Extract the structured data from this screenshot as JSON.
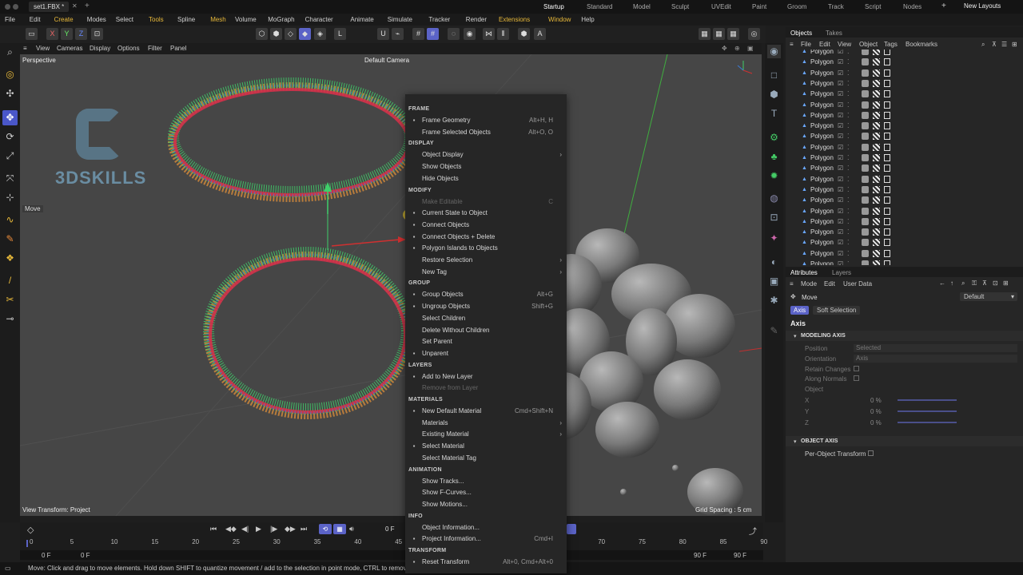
{
  "titlebar": {
    "doc_tab": "set1.FBX *",
    "layouts": [
      "Startup",
      "Standard",
      "Model",
      "Sculpt",
      "UVEdit",
      "Paint",
      "Groom",
      "Track",
      "Script",
      "Nodes"
    ],
    "active_layout": "Startup",
    "new_layouts": "New Layouts"
  },
  "menu": [
    "File",
    "Edit",
    "Create",
    "Modes",
    "Select",
    "Tools",
    "Spline",
    "Mesh",
    "Volume",
    "MoGraph",
    "Character",
    "Animate",
    "Simulate",
    "Tracker",
    "Render",
    "Extensions",
    "Window",
    "Help"
  ],
  "viewport": {
    "menu": [
      "View",
      "Cameras",
      "Display",
      "Options",
      "Filter",
      "Panel"
    ],
    "label": "Perspective",
    "camera": "Default Camera",
    "view_transform": "View Transform: Project",
    "grid_spacing": "Grid Spacing : 5 cm",
    "move_label": "Move",
    "logo_text": "3DSKILLS"
  },
  "context_menu": {
    "sections": [
      {
        "title": "FRAME",
        "items": [
          {
            "label": "Frame Geometry",
            "shortcut": "Alt+H, H",
            "icon": "frame-icon"
          },
          {
            "label": "Frame Selected Objects",
            "shortcut": "Alt+O, O",
            "icon": ""
          }
        ]
      },
      {
        "title": "DISPLAY",
        "items": [
          {
            "label": "Object Display",
            "submenu": true
          },
          {
            "label": "Show Objects"
          },
          {
            "label": "Hide Objects"
          }
        ]
      },
      {
        "title": "MODIFY",
        "items": [
          {
            "label": "Make Editable",
            "shortcut": "C",
            "disabled": true
          },
          {
            "label": "Current State to Object",
            "icon": "state-icon"
          },
          {
            "label": "Connect Objects",
            "icon": "connect-icon"
          },
          {
            "label": "Connect Objects + Delete",
            "icon": "connect-delete-icon"
          },
          {
            "label": "Polygon Islands to Objects",
            "icon": "islands-icon"
          },
          {
            "label": "Restore Selection",
            "submenu": true
          },
          {
            "label": "New Tag",
            "submenu": true
          }
        ]
      },
      {
        "title": "GROUP",
        "items": [
          {
            "label": "Group Objects",
            "shortcut": "Alt+G",
            "icon": "group-icon"
          },
          {
            "label": "Ungroup Objects",
            "shortcut": "Shift+G",
            "icon": "ungroup-icon"
          },
          {
            "label": "Select Children"
          },
          {
            "label": "Delete Without Children"
          },
          {
            "label": "Set Parent"
          },
          {
            "label": "Unparent",
            "icon": "unparent-icon"
          }
        ]
      },
      {
        "title": "LAYERS",
        "items": [
          {
            "label": "Add to New Layer",
            "icon": "layer-icon"
          },
          {
            "label": "Remove from Layer",
            "disabled": true
          }
        ]
      },
      {
        "title": "MATERIALS",
        "items": [
          {
            "label": "New Default Material",
            "shortcut": "Cmd+Shift+N",
            "icon": "plus-icon"
          },
          {
            "label": "Materials",
            "submenu": true
          },
          {
            "label": "Existing Material",
            "submenu": true
          },
          {
            "label": "Select Material",
            "icon": "select-material-icon"
          },
          {
            "label": "Select Material Tag"
          }
        ]
      },
      {
        "title": "ANIMATION",
        "items": [
          {
            "label": "Show Tracks..."
          },
          {
            "label": "Show F-Curves..."
          },
          {
            "label": "Show Motions..."
          }
        ]
      },
      {
        "title": "INFO",
        "items": [
          {
            "label": "Object Information..."
          },
          {
            "label": "Project Information...",
            "shortcut": "Cmd+I",
            "icon": "info-icon"
          }
        ]
      },
      {
        "title": "TRANSFORM",
        "items": [
          {
            "label": "Reset Transform",
            "shortcut": "Alt+0, Cmd+Alt+0",
            "icon": "reset-icon"
          }
        ]
      }
    ]
  },
  "objects_panel": {
    "tabs": [
      "Objects",
      "Takes"
    ],
    "menu": [
      "File",
      "Edit",
      "View",
      "Object",
      "Tags",
      "Bookmarks"
    ],
    "rows": [
      "Polygon",
      "Polygon",
      "Polygon",
      "Polygon",
      "Polygon",
      "Polygon",
      "Polygon",
      "Polygon",
      "Polygon",
      "Polygon",
      "Polygon",
      "Polygon",
      "Polygon",
      "Polygon",
      "Polygon",
      "Polygon",
      "Polygon",
      "Polygon",
      "Polygon",
      "Polygon",
      "Polygon"
    ]
  },
  "attributes_panel": {
    "tabs": [
      "Attributes",
      "Layers"
    ],
    "menu": [
      "Mode",
      "Edit",
      "User Data"
    ],
    "tool": "Move",
    "preset": "Default",
    "subtabs": [
      "Axis",
      "Soft Selection"
    ],
    "heading": "Axis",
    "modeling_axis_title": "MODELING AXIS",
    "position_label": "Position",
    "position_value": "Selected",
    "orientation_label": "Orientation",
    "orientation_value": "Axis",
    "retain_changes": "Retain Changes",
    "along_normals": "Along Normals",
    "object_label": "Object",
    "x_label": "X",
    "x_value": "0 %",
    "y_label": "Y",
    "y_value": "0 %",
    "z_label": "Z",
    "z_value": "0 %",
    "object_axis_title": "OBJECT AXIS",
    "per_object": "Per-Object Transform"
  },
  "timeline": {
    "current_frame": "0 F",
    "ticks": [
      "0",
      "5",
      "10",
      "15",
      "20",
      "25",
      "30",
      "35",
      "40",
      "45",
      "50",
      "55",
      "60",
      "65",
      "70",
      "75",
      "80",
      "85",
      "90"
    ],
    "start": "0 F",
    "start2": "0 F",
    "end": "90 F",
    "end2": "90 F"
  },
  "status": "Move: Click and drag to move elements. Hold down SHIFT to quantize movement / add to the selection in point mode, CTRL to remove.",
  "colors": {
    "accent": "#5b63c7",
    "menu_accent": "#e8b93a",
    "viewport": "#464646"
  }
}
